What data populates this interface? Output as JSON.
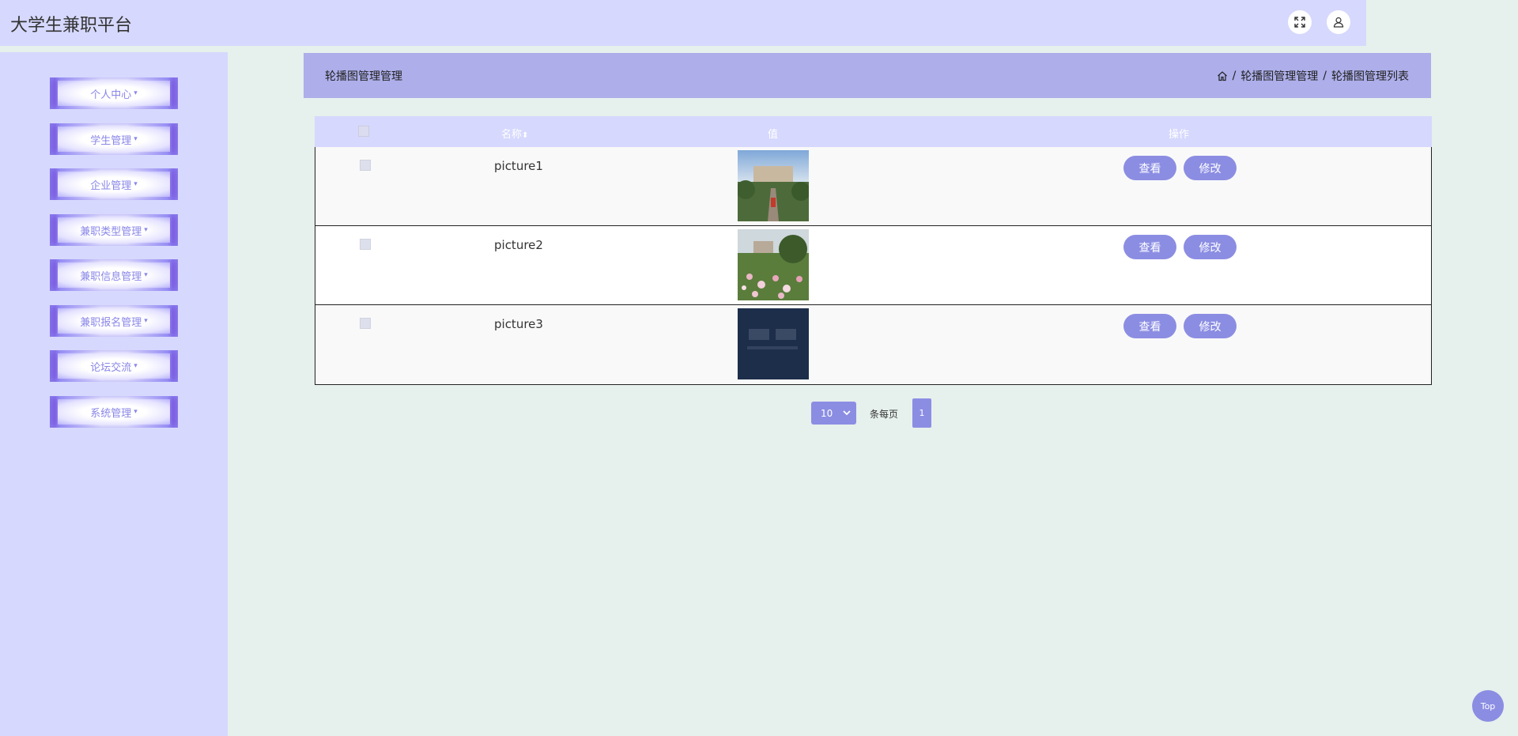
{
  "app": {
    "title": "大学生兼职平台"
  },
  "header": {
    "fullscreen_icon": "fullscreen-icon",
    "user_icon": "user-icon"
  },
  "sidebar": {
    "items": [
      {
        "label": "个人中心"
      },
      {
        "label": "学生管理"
      },
      {
        "label": "企业管理"
      },
      {
        "label": "兼职类型管理"
      },
      {
        "label": "兼职信息管理"
      },
      {
        "label": "兼职报名管理"
      },
      {
        "label": "论坛交流"
      },
      {
        "label": "系统管理"
      }
    ],
    "caret": "▾"
  },
  "page": {
    "title": "轮播图管理管理",
    "breadcrumb": {
      "sep": "/",
      "level1": "轮播图管理管理",
      "level2": "轮播图管理列表"
    }
  },
  "table": {
    "columns": {
      "name": "名称",
      "sort_glyph": "⬍",
      "value": "值",
      "action": "操作"
    },
    "rows": [
      {
        "name": "picture1",
        "image": "campus-road-photo"
      },
      {
        "name": "picture2",
        "image": "flower-garden-photo"
      },
      {
        "name": "picture3",
        "image": "dark-sign-photo"
      }
    ],
    "actions": {
      "view": "查看",
      "edit": "修改"
    }
  },
  "pagination": {
    "page_size": "10",
    "per_page_label": "条每页",
    "current_page": "1"
  },
  "fab": {
    "label": "Top"
  },
  "colors": {
    "accent": "#8b8de3",
    "header_bg": "#d6d8fd",
    "page_header_bg": "#adaeea",
    "background": "#e6f0ec"
  }
}
